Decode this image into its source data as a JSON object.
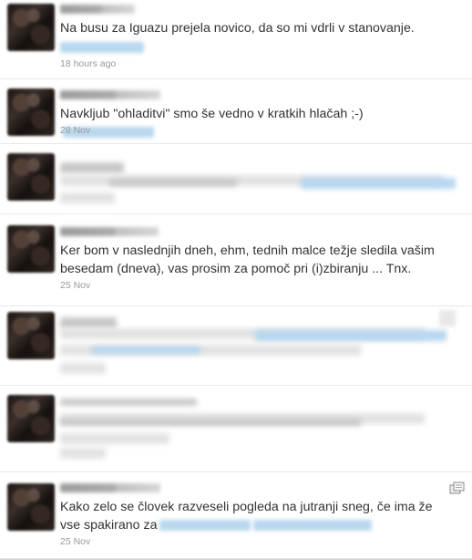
{
  "tweets": [
    {
      "text": "Na busu za Iguazu prejela novico, da so mi vdrli v stanovanje.",
      "timestamp": "18 hours ago"
    },
    {
      "text": "Navkljub \"ohladitvi\" smo še vedno v kratkih hlačah ;-)",
      "timestamp": "28 Nov"
    },
    {
      "text": "Ker bom v naslednjih dneh, ehm, tednih malce težje sledila vašim besedam (dneva), vas prosim za pomoč pri (i)zbiranju ... Tnx.",
      "timestamp": "25 Nov"
    },
    {
      "text": "Kako zelo se človek razveseli pogleda na jutranji sneg, če ima že vse spakirano za",
      "timestamp": "25 Nov"
    }
  ],
  "icons": {
    "retweet": "retweet-icon"
  }
}
